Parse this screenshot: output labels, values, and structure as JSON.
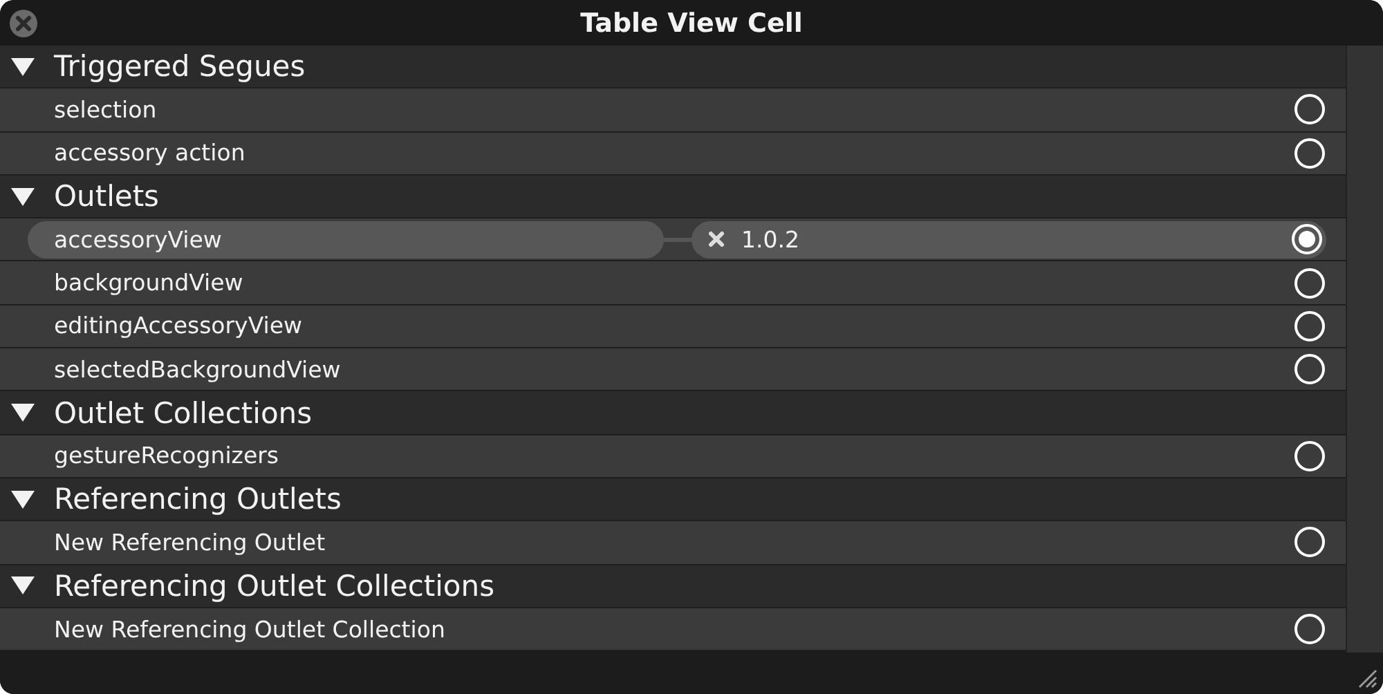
{
  "window": {
    "title": "Table View Cell"
  },
  "sections": [
    {
      "label": "Triggered Segues",
      "expanded": true,
      "items": [
        {
          "label": "selection",
          "connected": false
        },
        {
          "label": "accessory action",
          "connected": false
        }
      ]
    },
    {
      "label": "Outlets",
      "expanded": true,
      "items": [
        {
          "label": "accessoryView",
          "connected": true,
          "connection": "1.0.2"
        },
        {
          "label": "backgroundView",
          "connected": false
        },
        {
          "label": "editingAccessoryView",
          "connected": false
        },
        {
          "label": "selectedBackgroundView",
          "connected": false
        }
      ]
    },
    {
      "label": "Outlet Collections",
      "expanded": true,
      "items": [
        {
          "label": "gestureRecognizers",
          "connected": false
        }
      ]
    },
    {
      "label": "Referencing Outlets",
      "expanded": true,
      "items": [
        {
          "label": "New Referencing Outlet",
          "connected": false
        }
      ]
    },
    {
      "label": "Referencing Outlet Collections",
      "expanded": true,
      "items": [
        {
          "label": "New Referencing Outlet Collection",
          "connected": false
        }
      ]
    }
  ]
}
